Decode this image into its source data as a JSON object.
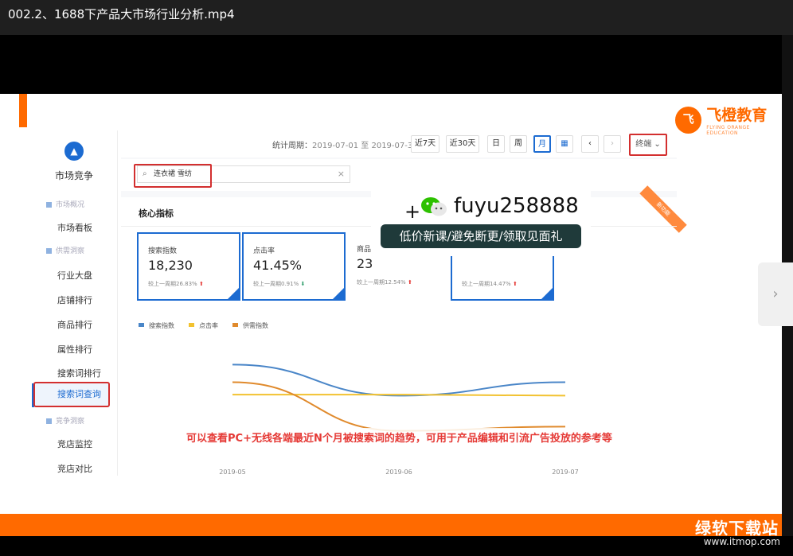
{
  "window": {
    "title": "002.2、1688下产品大市场行业分析.mp4"
  },
  "logo": {
    "mark": "飞",
    "main": "飞橙教育",
    "sub": "FLYING ORANGE EDUCATION"
  },
  "sidebar": {
    "title": "市场竞争",
    "groups": [
      "市场概况",
      "供需洞察",
      "竞争洞察"
    ],
    "items": [
      "市场看板",
      "行业大盘",
      "店铺排行",
      "商品排行",
      "属性排行",
      "搜索词排行",
      "搜索词查询",
      "竞店监控",
      "竞店对比"
    ],
    "active": "搜索词查询"
  },
  "topbar": {
    "period_label": "统计周期：",
    "period_value": "2019-07-01 至 2019-07-31",
    "buttons": [
      "近7天",
      "近30天",
      "日",
      "周",
      "月"
    ],
    "selected": "月",
    "calendar_icon": "calendar-icon",
    "prev": "‹",
    "next": "›",
    "terminal": "终端"
  },
  "search": {
    "value": "连衣裙 雪纺",
    "clear": "×"
  },
  "core": {
    "title": "核心指标",
    "ribbon": "新功能",
    "cards": [
      {
        "label": "搜索指数",
        "value": "18,230",
        "compare": "较上一周期26.83%",
        "trend": "up"
      },
      {
        "label": "点击率",
        "value": "41.45%",
        "compare": "较上一周期0.91%",
        "trend": "down"
      },
      {
        "label": "商品",
        "value": "23",
        "compare": "较上一周期12.54%",
        "trend": "up"
      },
      {
        "label": "",
        "value": "",
        "compare": "较上一周期14.47%",
        "trend": "up"
      }
    ]
  },
  "chart_data": {
    "type": "line",
    "x": [
      "2019-05",
      "2019-06",
      "2019-07"
    ],
    "series": [
      {
        "name": "搜索指数",
        "color": "#4a86c8",
        "values": [
          92,
          62,
          75
        ]
      },
      {
        "name": "点击率",
        "color": "#f2c230",
        "values": [
          63,
          63,
          62
        ]
      },
      {
        "name": "供需指数",
        "color": "#e08a2c",
        "values": [
          75,
          28,
          32
        ]
      }
    ],
    "ylim": [
      0,
      100
    ],
    "grid": false,
    "legend": "top-left"
  },
  "overlay": {
    "plus": "+",
    "wechat_icon": "wechat-icon",
    "id": "fuyu258888",
    "note": "低价新课/避免断更/领取见面礼"
  },
  "caption": "可以查看PC+无线各端最近N个月被搜索词的趋势，可用于产品编辑和引流广告投放的参考等",
  "watermark": {
    "brand": "绿软下载站",
    "url": "www.itmop.com"
  },
  "side_handle": "›"
}
